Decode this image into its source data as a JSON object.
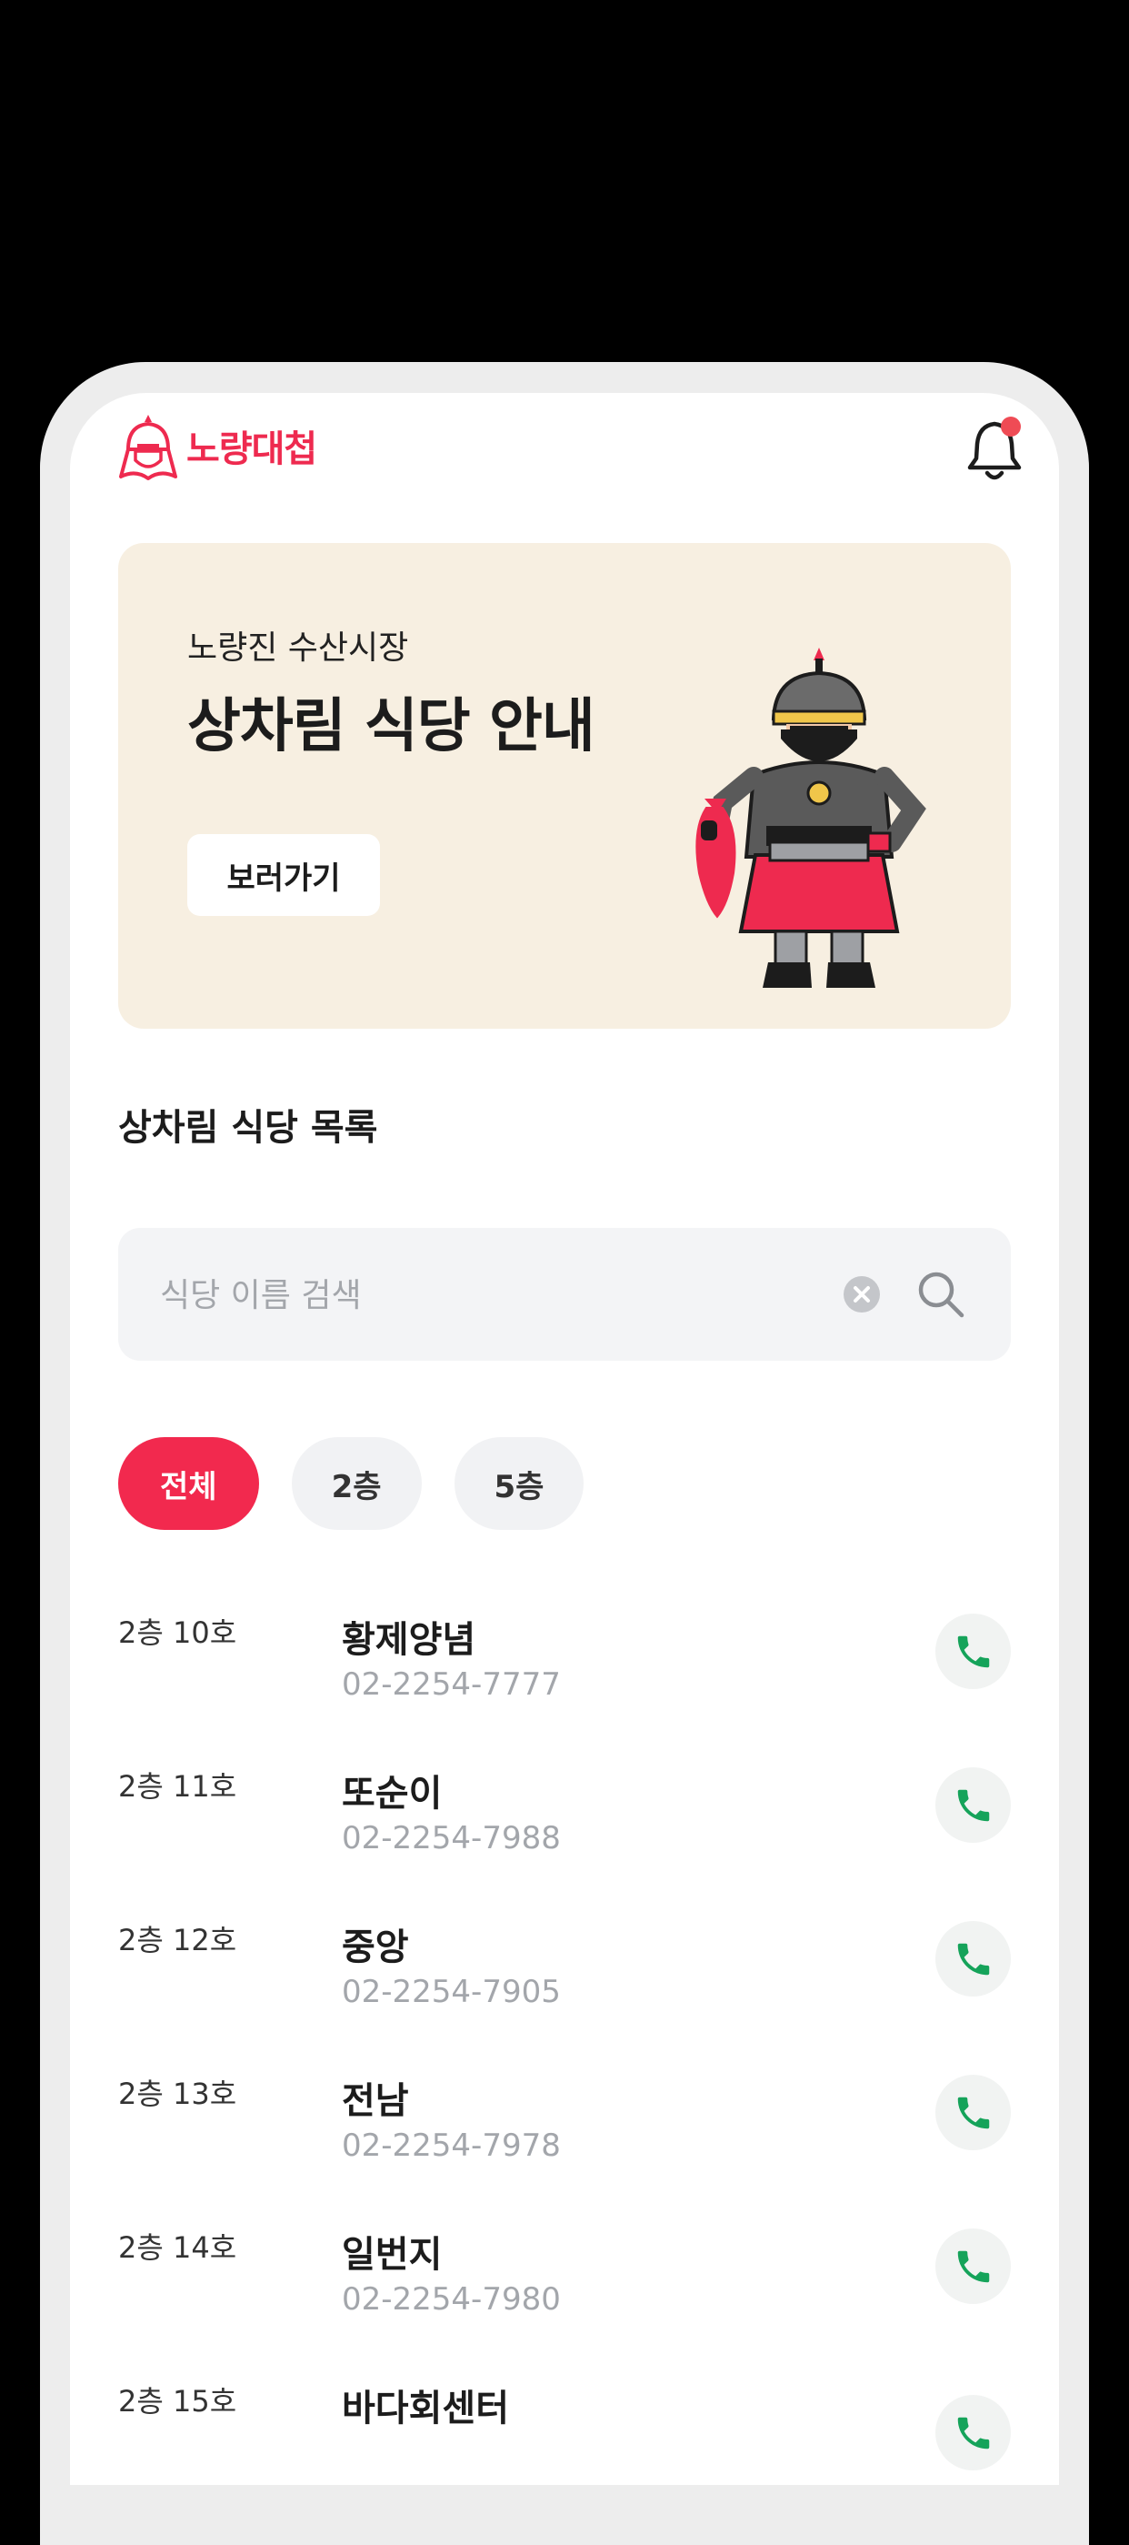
{
  "header": {
    "logo_text": "노량대첩",
    "notification_badge": true
  },
  "banner": {
    "subtitle": "노량진 수산시장",
    "title": "상차림 식당 안내",
    "button_label": "보러가기"
  },
  "list": {
    "title": "상차림 식당 목록"
  },
  "search": {
    "placeholder": "식당 이름 검색"
  },
  "filters": [
    {
      "label": "전체",
      "active": true
    },
    {
      "label": "2층",
      "active": false
    },
    {
      "label": "5층",
      "active": false
    }
  ],
  "restaurants": [
    {
      "floor": "2층 10호",
      "name": "황제양념",
      "phone": "02-2254-7777"
    },
    {
      "floor": "2층 11호",
      "name": "또순이",
      "phone": "02-2254-7988"
    },
    {
      "floor": "2층 12호",
      "name": "중앙",
      "phone": "02-2254-7905"
    },
    {
      "floor": "2층 13호",
      "name": "전남",
      "phone": "02-2254-7978"
    },
    {
      "floor": "2층 14호",
      "name": "일번지",
      "phone": "02-2254-7980"
    },
    {
      "floor": "2층 15호",
      "name": "바다회센터",
      "phone": ""
    }
  ],
  "colors": {
    "brand": "#ee2a4f",
    "banner_bg": "#f7efe1",
    "call_icon": "#15a35a"
  }
}
